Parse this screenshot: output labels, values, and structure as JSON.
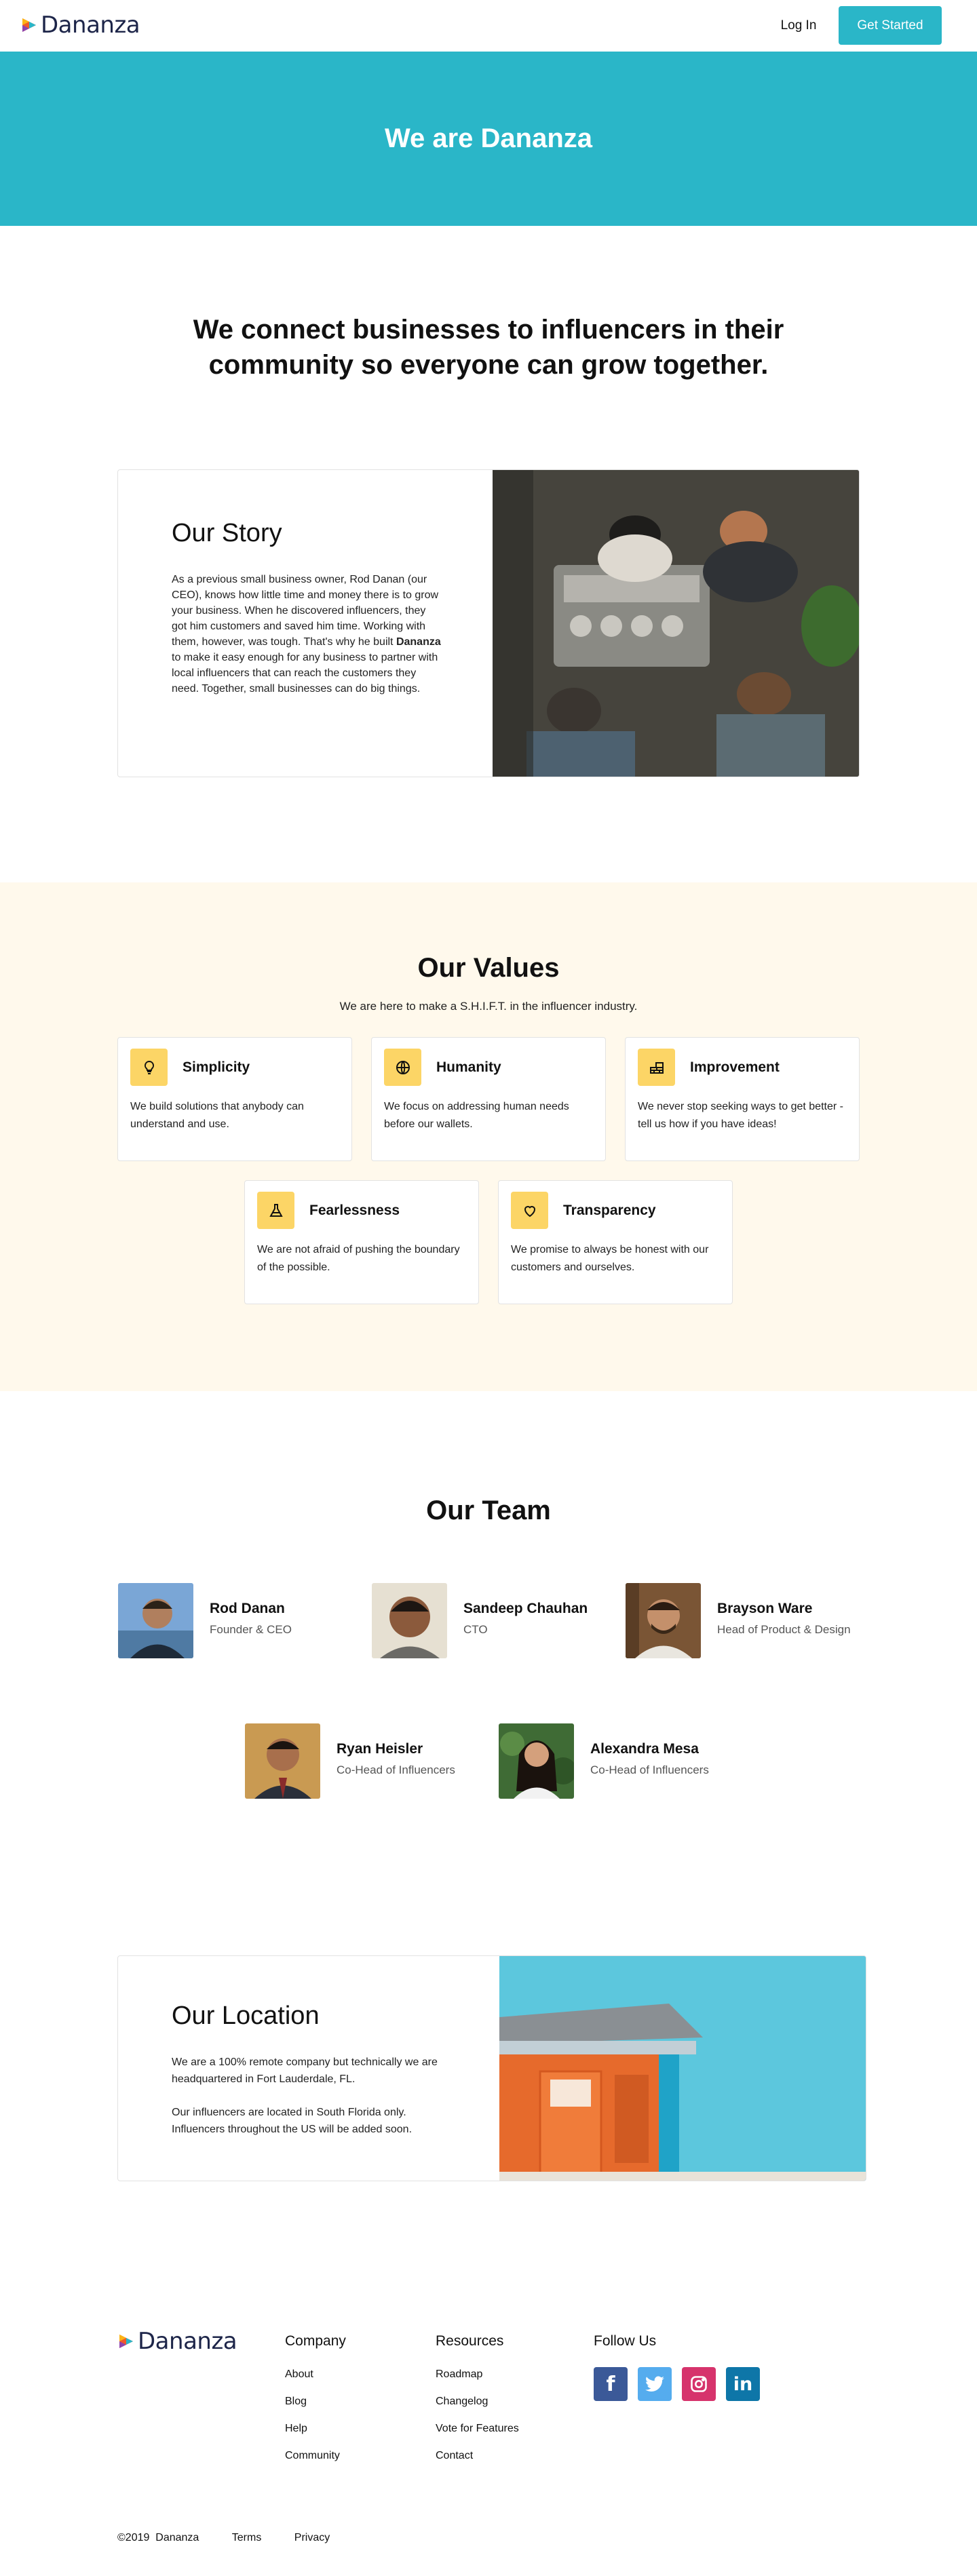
{
  "brand": {
    "name": "Dananza",
    "accent": "#2ab6c8",
    "highlight": "#fcd566",
    "values_bg": "#fff9ec",
    "logo_icon": "dananza-play-logo-icon"
  },
  "nav": {
    "login_label": "Log In",
    "cta_label": "Get Started"
  },
  "hero": {
    "title": "We are Dananza"
  },
  "mission": {
    "text": "We connect businesses to influencers in their community so everyone can grow together."
  },
  "story": {
    "title": "Our Story",
    "body_before": "As a previous small business owner, Rod Danan (our CEO), knows how little time and money there is to grow your business. When he discovered influencers, they got him customers and saved him time. Working with them, however, was tough. That's why he built ",
    "body_bold": "Dananza",
    "body_after": " to make it easy enough for any business to partner with local influencers that can reach the customers they need. Together, small businesses can do big things.",
    "image": "coffee-shop-baristas-photo"
  },
  "values": {
    "title": "Our Values",
    "subtitle": "We are here to make a S.H.I.F.T. in the influencer industry.",
    "items": [
      {
        "title": "Simplicity",
        "desc": "We build solutions that anybody can understand and use.",
        "icon": "lightbulb-icon"
      },
      {
        "title": "Humanity",
        "desc": "We focus on addressing human needs before our wallets.",
        "icon": "globe-icon"
      },
      {
        "title": "Improvement",
        "desc": "We never stop seeking ways to get better - tell us how if you have ideas!",
        "icon": "bricks-icon"
      },
      {
        "title": "Fearlessness",
        "desc": "We are not afraid of pushing the boundary of the possible.",
        "icon": "flask-icon"
      },
      {
        "title": "Transparency",
        "desc": "We promise to always be honest with our customers and ourselves.",
        "icon": "heart-icon"
      }
    ]
  },
  "team": {
    "title": "Our Team",
    "members": [
      {
        "name": "Rod Danan",
        "role": "Founder & CEO"
      },
      {
        "name": "Sandeep Chauhan",
        "role": "CTO"
      },
      {
        "name": "Brayson Ware",
        "role": "Head of Product & Design"
      },
      {
        "name": "Ryan Heisler",
        "role": "Co-Head of Influencers"
      },
      {
        "name": "Alexandra Mesa",
        "role": "Co-Head of Influencers"
      }
    ]
  },
  "location": {
    "title": "Our Location",
    "p1": "We are a 100% remote company but technically we are headquartered in Fort Lauderdale, FL.",
    "p2": "Our influencers are located in South Florida only. Influencers throughout the US will be added soon.",
    "image": "lifeguard-tower-photo"
  },
  "footer": {
    "company": {
      "title": "Company",
      "links": [
        "About",
        "Blog",
        "Help",
        "Community"
      ]
    },
    "resources": {
      "title": "Resources",
      "links": [
        "Roadmap",
        "Changelog",
        "Vote for Features",
        "Contact"
      ]
    },
    "follow": {
      "title": "Follow Us",
      "networks": [
        {
          "icon": "facebook-icon",
          "glyph": "f",
          "color": "#3b5998"
        },
        {
          "icon": "twitter-icon",
          "glyph": "",
          "color": "#55acee"
        },
        {
          "icon": "instagram-icon",
          "glyph": "",
          "color": "#d6336c"
        },
        {
          "icon": "linkedin-icon",
          "glyph": "in",
          "color": "#0e76a8"
        }
      ]
    },
    "copyright": "©2019  Dananza",
    "terms": "Terms",
    "privacy": "Privacy"
  }
}
